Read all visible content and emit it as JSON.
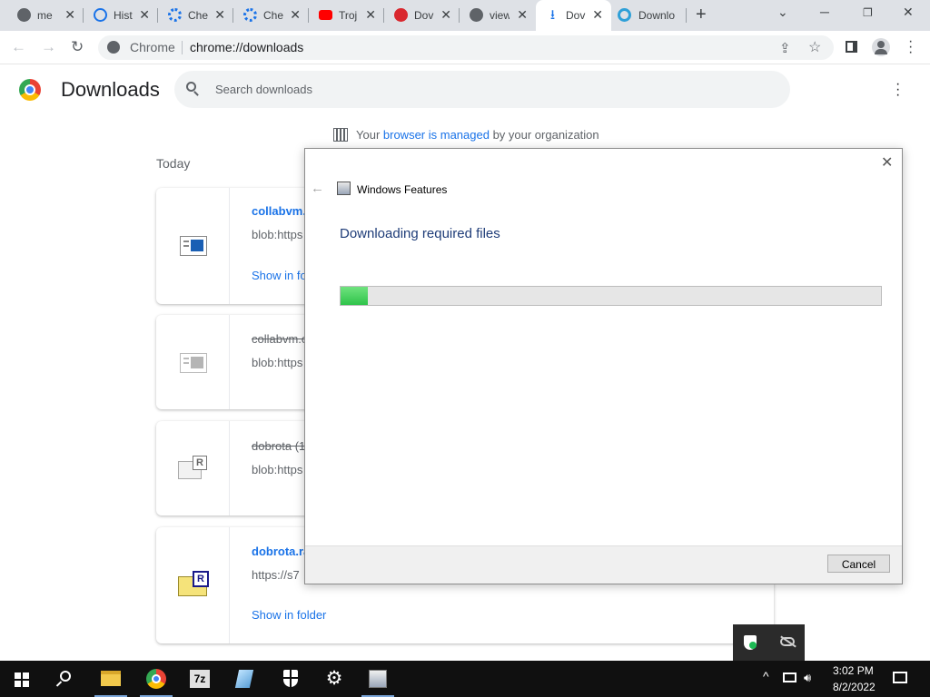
{
  "browser": {
    "tabs": [
      {
        "label": "me",
        "icon": "github-icon",
        "active": false
      },
      {
        "label": "Hist",
        "icon": "history-icon",
        "active": false
      },
      {
        "label": "Che",
        "icon": "settings-icon",
        "active": false
      },
      {
        "label": "Che",
        "icon": "settings-icon",
        "active": false
      },
      {
        "label": "Troj",
        "icon": "youtube-icon",
        "active": false
      },
      {
        "label": "Dov",
        "icon": "mega-icon",
        "active": false
      },
      {
        "label": "view",
        "icon": "github-icon",
        "active": false
      },
      {
        "label": "Dov",
        "icon": "download-icon",
        "active": true
      },
      {
        "label": "Downlo",
        "icon": "edge-icon",
        "active": false
      }
    ],
    "omnibox_chip": "Chrome",
    "url": "chrome://downloads"
  },
  "downloads": {
    "title": "Downloads",
    "search_placeholder": "Search downloads",
    "managed_prefix": "Your ",
    "managed_link": "browser is managed",
    "managed_suffix": " by your organization",
    "section": "Today",
    "items": [
      {
        "name": "collabvm.c",
        "url": "blob:https",
        "link": "Show in fo",
        "done": false
      },
      {
        "name": "collabvm.c",
        "url": "blob:https",
        "link": "",
        "done": true
      },
      {
        "name": "dobrota (1",
        "url": "blob:https",
        "link": "",
        "done": true
      },
      {
        "name": "dobrota.ra",
        "url": "https://s7",
        "link": "Show in folder",
        "done": false
      }
    ]
  },
  "dialog": {
    "title": "Windows Features",
    "heading": "Downloading required files",
    "progress": 0.05,
    "cancel_label": "Cancel"
  },
  "taskbar": {
    "time": "3:02 PM",
    "date": "8/2/2022"
  }
}
